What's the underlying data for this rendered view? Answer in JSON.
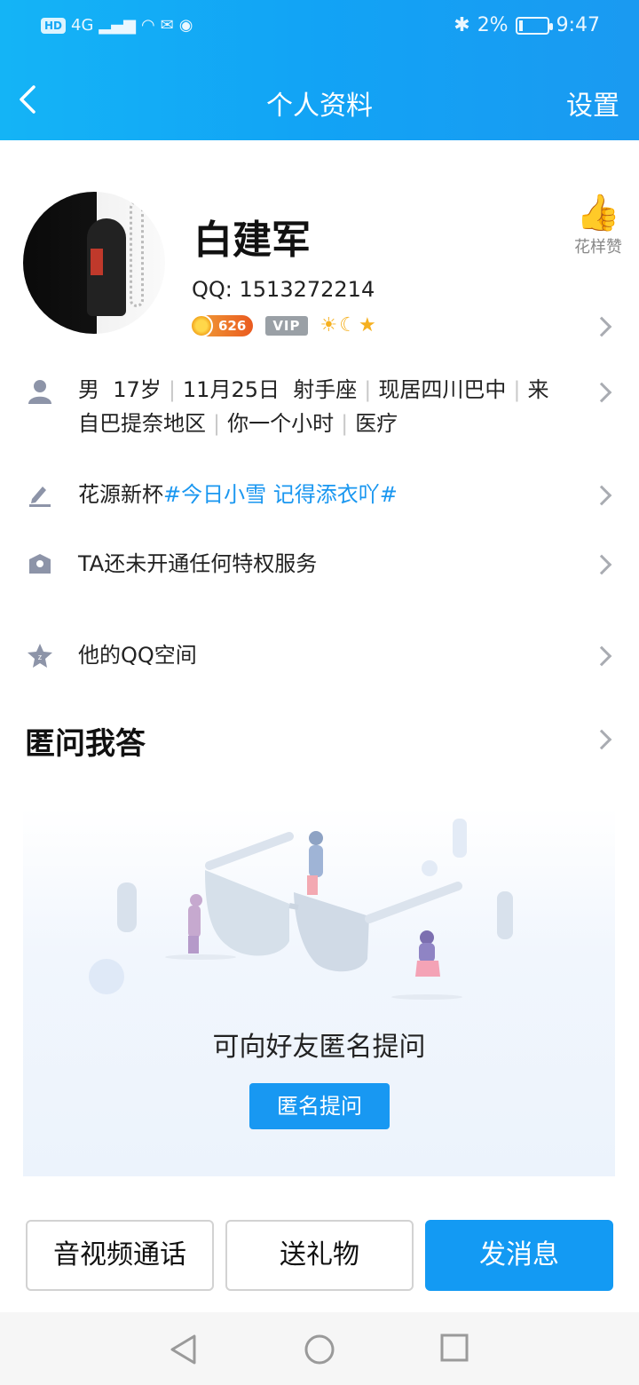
{
  "status_bar": {
    "left_items": [
      "HD",
      "4G"
    ],
    "battery": "2%",
    "time": "9:47"
  },
  "nav": {
    "title": "个人资料",
    "settings_label": "设置"
  },
  "profile": {
    "name": "白建军",
    "qq_label": "QQ:",
    "qq_number": "1513272214",
    "level_badge": "626",
    "vip_badge": "VIP",
    "like_label": "花样赞"
  },
  "info": {
    "gender": "男",
    "age": "17岁",
    "birthday": "11月25日",
    "zodiac": "射手座",
    "residence": "现居四川巴中",
    "hometown": "来自巴提奈地区",
    "extra": "你一个小时",
    "job": "医疗"
  },
  "signature": {
    "prefix": "花源新杯",
    "topic": "#今日小雪 记得添衣吖#"
  },
  "privilege": "TA还未开通任何特权服务",
  "qzone": "他的QQ空间",
  "qa": {
    "title": "匿问我答",
    "message": "可向好友匿名提问",
    "button": "匿名提问"
  },
  "actions": {
    "call": "音视频通话",
    "gift": "送礼物",
    "message": "发消息"
  },
  "colors": {
    "header": "#12a3f5",
    "accent": "#139af3",
    "topic": "#1a97f0"
  }
}
